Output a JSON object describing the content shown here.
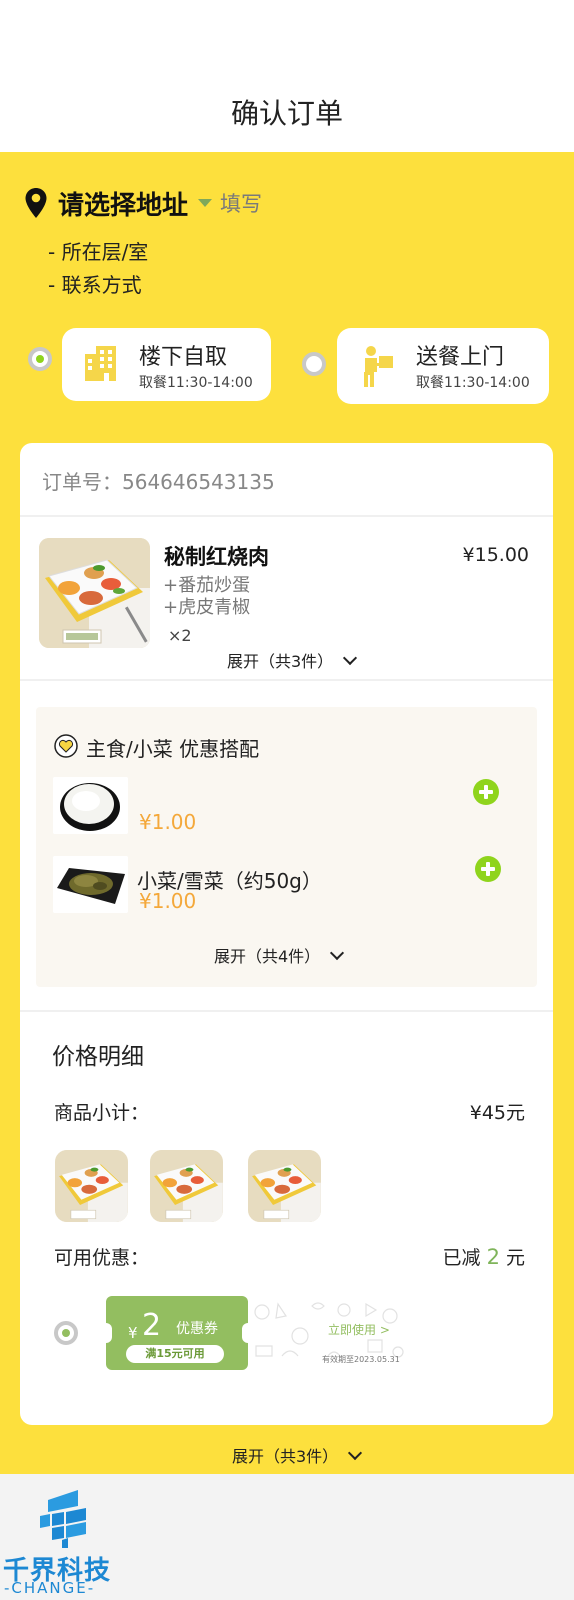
{
  "header": {
    "title": "确认订单"
  },
  "address": {
    "main": "请选择地址",
    "fill_link": "填写",
    "lines": [
      "- 所在层/室",
      "-  联系方式"
    ]
  },
  "options": [
    {
      "label": "楼下自取",
      "time": "取餐11:30-14:00",
      "selected": true,
      "icon": "building-icon"
    },
    {
      "label": "送餐上门",
      "time": "取餐11:30-14:00",
      "selected": false,
      "icon": "delivery-person-icon"
    }
  ],
  "order": {
    "number_label": "订单号：",
    "number": "564646543135",
    "item": {
      "name": "秘制红烧肉",
      "price": "¥15.00",
      "addons": [
        "+番茄炒蛋",
        "+虎皮青椒"
      ],
      "qty": "×2"
    },
    "expand_label": "展开（共3件）"
  },
  "combo": {
    "title": "主食/小菜 优惠搭配",
    "items": [
      {
        "name": "",
        "price": "¥1.00",
        "image": "rice"
      },
      {
        "name": "小菜/雪菜（约50g）",
        "price": "¥1.00",
        "image": "pickled-greens"
      }
    ],
    "expand_label": "展开（共4件）"
  },
  "price_detail": {
    "title": "价格明细",
    "subtotal_label": "商品小计：",
    "subtotal_value": "¥45元",
    "discount_label": "可用优惠：",
    "discount_prefix": "已减",
    "discount_amount": "2",
    "discount_unit": "元"
  },
  "coupon": {
    "yen": "¥",
    "amount": "2",
    "type": "优惠券",
    "condition": "满15元可用",
    "use_link": "立即使用 >",
    "expiry": "有效期至2023.05.31"
  },
  "bottom_expand": "展开（共3件）",
  "footer": {
    "logo_text": "千界科技",
    "logo_sub": "-CHANGE-"
  },
  "colors": {
    "brand_yellow": "#fde03d",
    "accent_green": "#93be60",
    "price_orange": "#f4a83a",
    "logo_blue": "#1d88d3"
  }
}
